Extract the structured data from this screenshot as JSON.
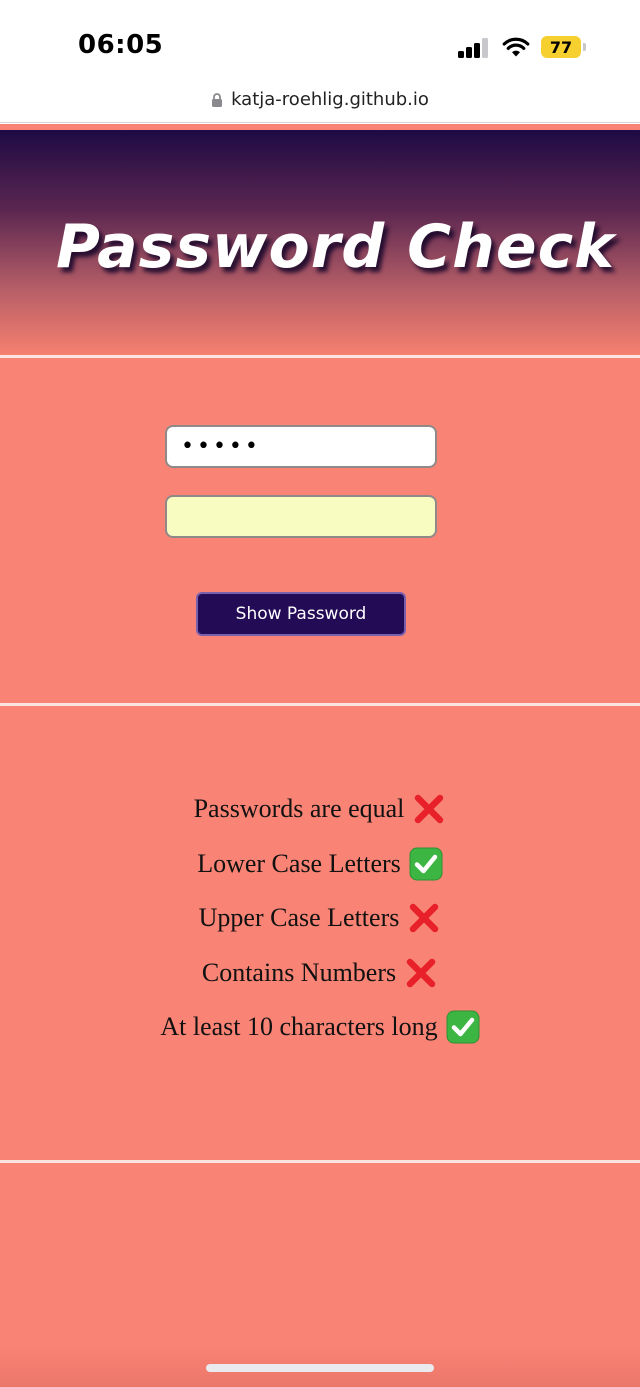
{
  "status_bar": {
    "time": "06:05",
    "battery_level": "77",
    "battery_color": "#f6d02e",
    "signal_icon": "cellular-signal-icon",
    "wifi_icon": "wifi-icon"
  },
  "browser": {
    "url": "katja-roehlig.github.io",
    "lock_icon": "lock-icon"
  },
  "header": {
    "title": "Password Check"
  },
  "form": {
    "password_value": "•••••",
    "confirm_value": "",
    "show_button_label": "Show Password"
  },
  "checklist": [
    {
      "label": "Passwords are equal",
      "status": "fail",
      "icon": "cross-mark-icon"
    },
    {
      "label": "Lower Case Letters",
      "status": "pass",
      "icon": "check-mark-icon"
    },
    {
      "label": "Upper Case Letters",
      "status": "fail",
      "icon": "cross-mark-icon"
    },
    {
      "label": "Contains Numbers",
      "status": "fail",
      "icon": "cross-mark-icon"
    },
    {
      "label": "At least 10 characters long",
      "status": "pass",
      "icon": "check-mark-icon"
    }
  ],
  "colors": {
    "background": "#f98475",
    "button": "#230b56",
    "confirm_field": "#f8fcc0",
    "pass": "#3cb543",
    "fail": "#e8202a"
  }
}
